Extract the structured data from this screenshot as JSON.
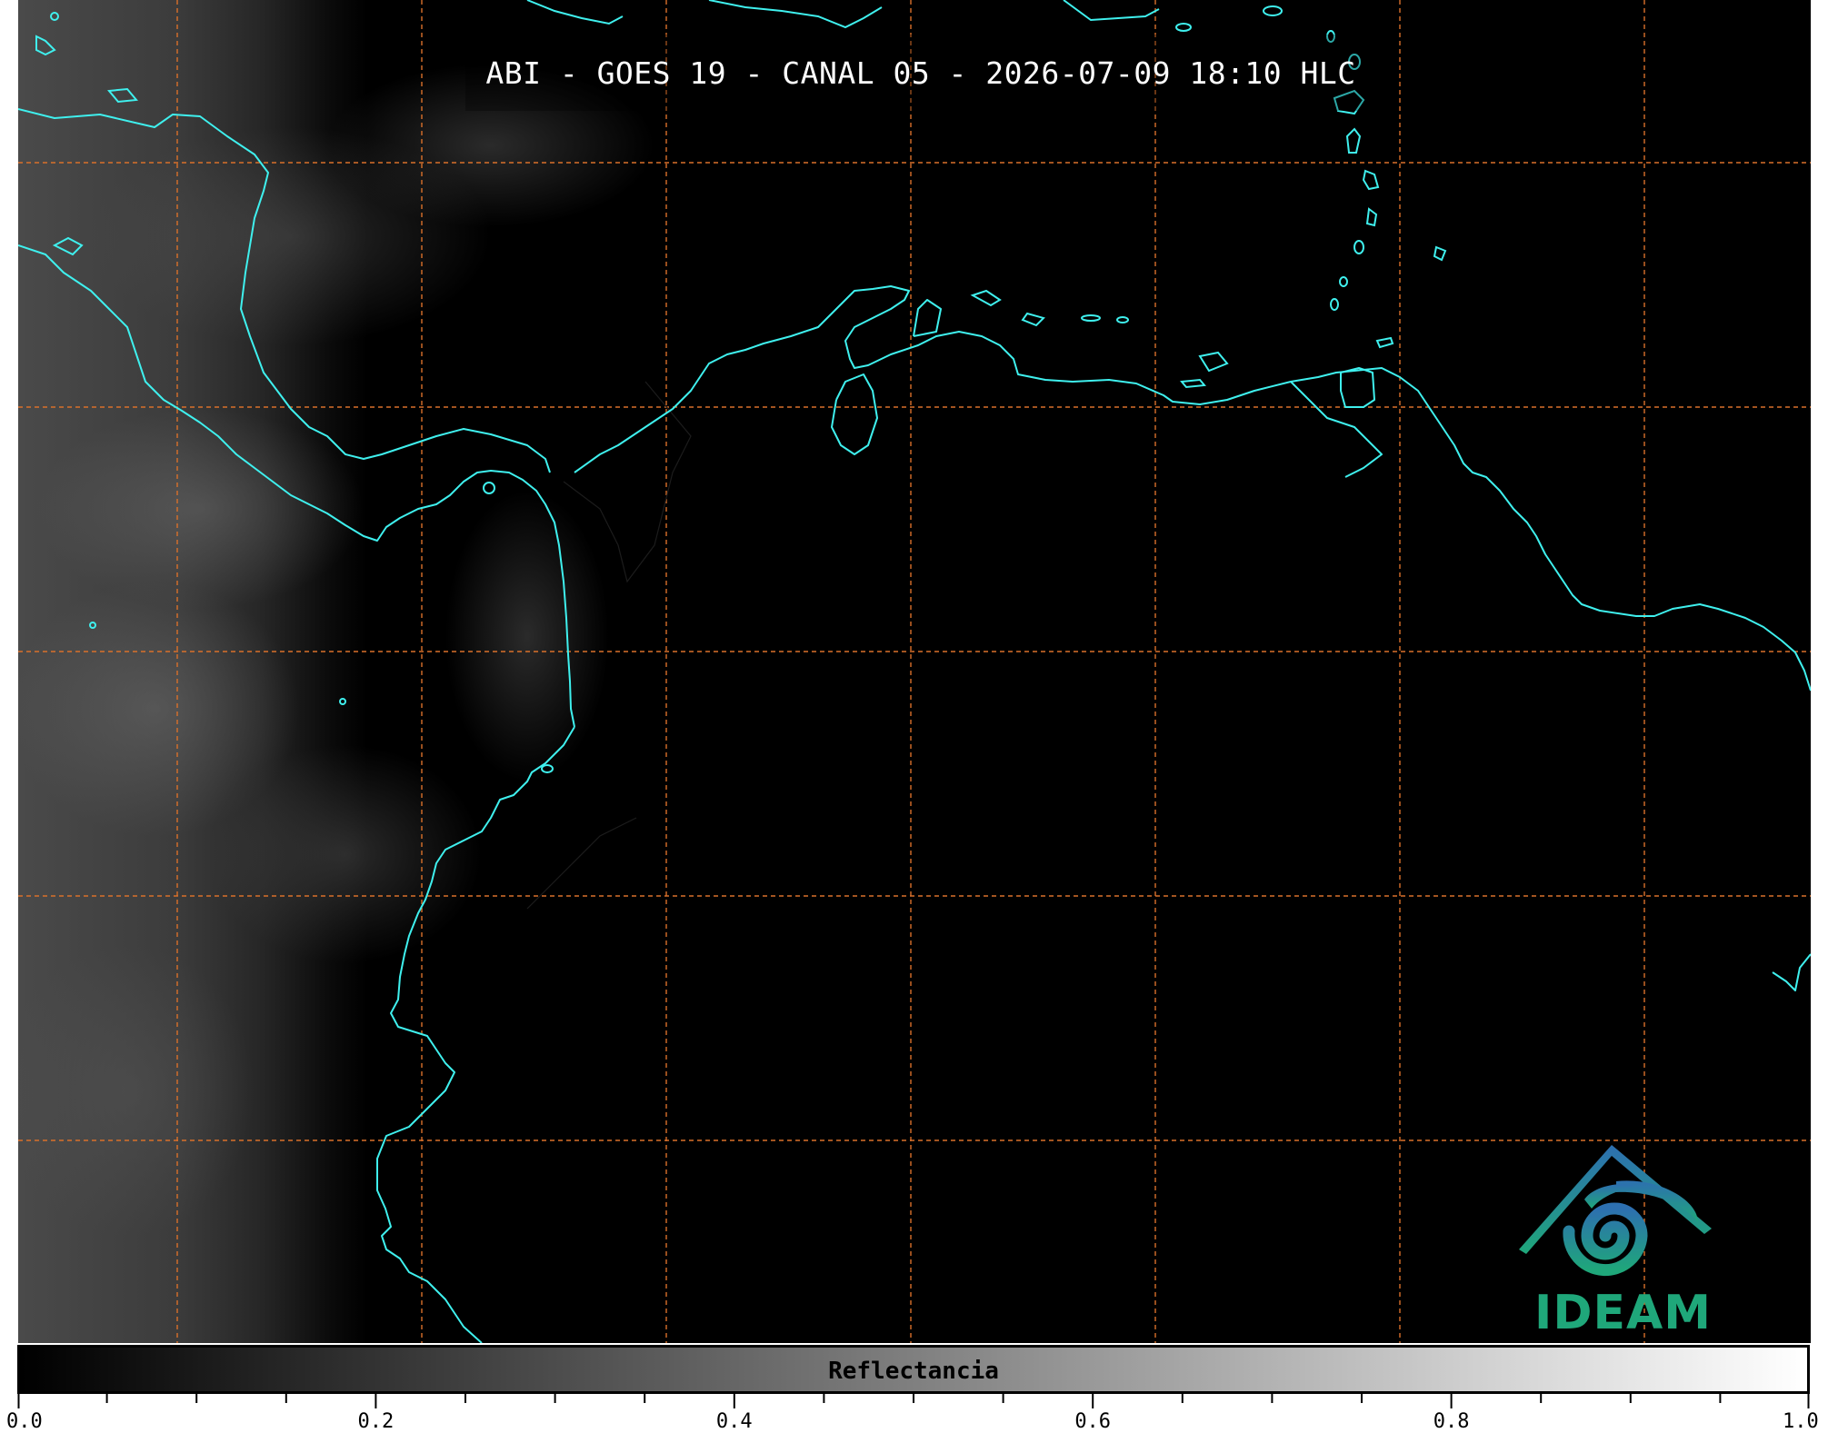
{
  "title": "ABI - GOES 19 - CANAL 05 - 2026-07-09 18:10 HLC",
  "logo": {
    "text": "IDEAM",
    "icon": "ideam-logo-icon",
    "color": "#1fa77a"
  },
  "map": {
    "background": "#000000",
    "coastline_color": "#3ff0ee",
    "grid_color": "#d9702a",
    "grid_style": "dashed"
  },
  "colorbar": {
    "label": "Reflectancia",
    "min": 0.0,
    "max": 1.0,
    "gradient": [
      "#000000",
      "#ffffff"
    ],
    "tick_labels": [
      "0.0",
      "0.2",
      "0.4",
      "0.6",
      "0.8",
      "1.0"
    ],
    "minor_ticks": 20
  }
}
